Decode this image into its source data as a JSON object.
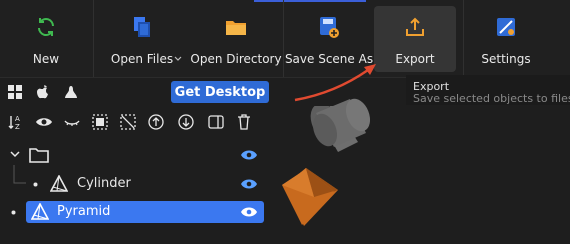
{
  "toolbar": {
    "new_label": "New",
    "open_files_label": "Open Files",
    "open_directory_label": "Open Directory",
    "save_scene_as_label": "Save Scene As",
    "export_label": "Export",
    "settings_label": "Settings"
  },
  "tooltip": {
    "title": "Export",
    "description": "Save selected objects to files."
  },
  "platform": {
    "get_desktop_label": "Get Desktop"
  },
  "tree": {
    "items": [
      {
        "label": ""
      },
      {
        "label": "Cylinder"
      },
      {
        "label": "Pyramid"
      }
    ]
  },
  "colors": {
    "accent": "#3b78f0",
    "button": "#2f6bd6",
    "new_icon": "#3fb950",
    "folder_icon": "#f0a030",
    "file_icon": "#3b78f0",
    "arrow": "#e04a30",
    "pyramid": "#c86a1e",
    "cylinder": "#6a6a6a"
  }
}
